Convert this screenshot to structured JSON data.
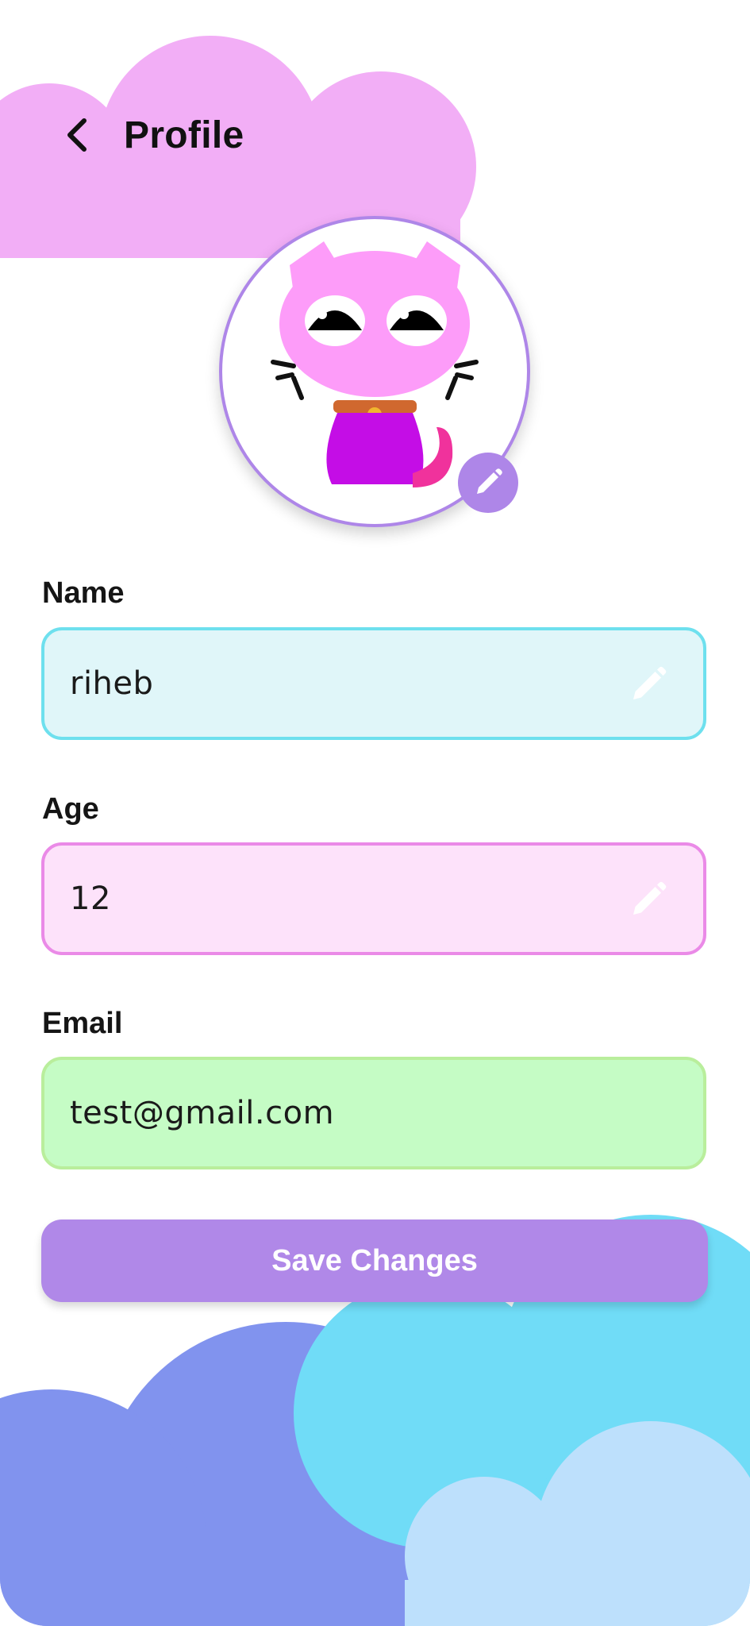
{
  "header": {
    "title": "Profile"
  },
  "avatar": {
    "description_icon": "cat-avatar",
    "edit_icon": "pencil-icon"
  },
  "form": {
    "name": {
      "label": "Name",
      "value": "riheb",
      "color_bg": "#e0f6f9",
      "color_border": "#6ee0ee"
    },
    "age": {
      "label": "Age",
      "value": "12",
      "color_bg": "#fde2fa",
      "color_border": "#ea8ae7"
    },
    "email": {
      "label": "Email",
      "value": "test@gmail.com",
      "color_bg": "#c5fcc5",
      "color_border": "#b9ee9c"
    }
  },
  "save_button": {
    "label": "Save Changes",
    "color": "#b088e8"
  },
  "colors": {
    "top_cloud": "#f2aef6",
    "bottom_cloud_blue": "#8193ee",
    "bottom_cloud_cyan": "#70dcf7",
    "bottom_cloud_light": "#bde0fc",
    "accent": "#ae86e8"
  }
}
